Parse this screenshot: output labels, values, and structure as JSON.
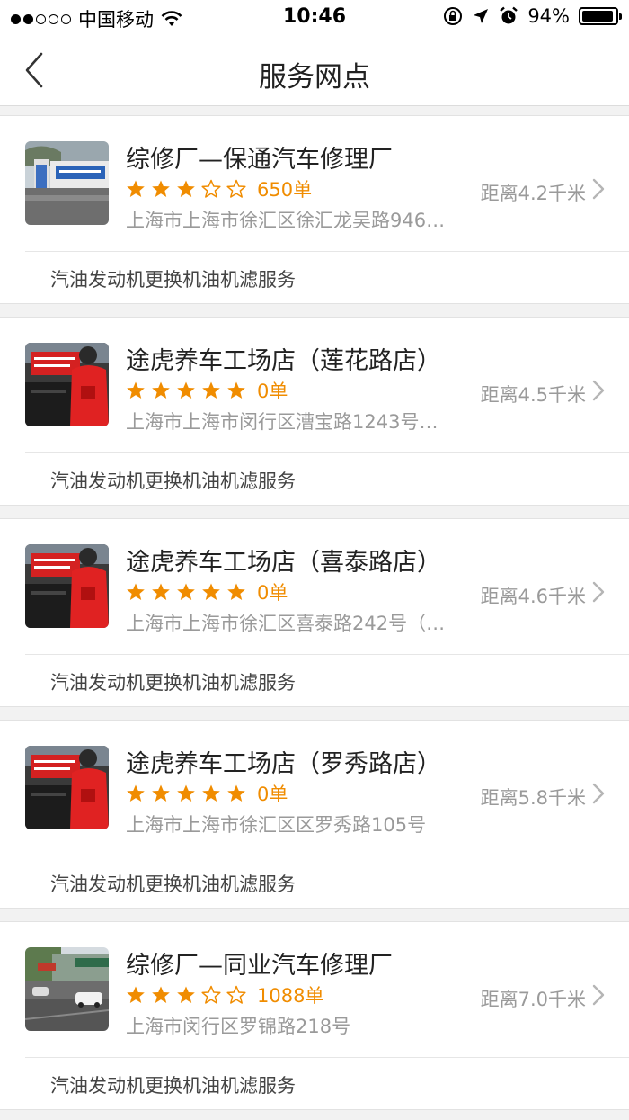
{
  "status_bar": {
    "carrier": "中国移动",
    "time": "10:46",
    "battery": "94%",
    "battery_level": 0.94,
    "signal_bars_filled": 2,
    "signal_bars_total": 5
  },
  "header": {
    "title": "服务网点"
  },
  "accent_color": "#f08c00",
  "stores": [
    {
      "name": "综修厂—保通汽车修理厂",
      "rating": 3,
      "orders": "650单",
      "address": "上海市上海市徐汇区徐汇龙吴路946…",
      "distance": "距离4.2千米",
      "service": "汽油发动机更换机油机滤服务",
      "thumb": "repair-shop"
    },
    {
      "name": "途虎养车工场店（莲花路店）",
      "rating": 5,
      "orders": "0单",
      "address": "上海市上海市闵行区漕宝路1243号…",
      "distance": "距离4.5千米",
      "service": "汽油发动机更换机油机滤服务",
      "thumb": "tuhu"
    },
    {
      "name": "途虎养车工场店（喜泰路店）",
      "rating": 5,
      "orders": "0单",
      "address": "上海市上海市徐汇区喜泰路242号（…",
      "distance": "距离4.6千米",
      "service": "汽油发动机更换机油机滤服务",
      "thumb": "tuhu"
    },
    {
      "name": "途虎养车工场店（罗秀路店）",
      "rating": 5,
      "orders": "0单",
      "address": "上海市上海市徐汇区区罗秀路105号",
      "distance": "距离5.8千米",
      "service": "汽油发动机更换机油机滤服务",
      "thumb": "tuhu"
    },
    {
      "name": "综修厂—同业汽车修理厂",
      "rating": 3,
      "orders": "1088单",
      "address": "上海市闵行区罗锦路218号",
      "distance": "距离7.0千米",
      "service": "汽油发动机更换机油机滤服务",
      "thumb": "street"
    }
  ]
}
